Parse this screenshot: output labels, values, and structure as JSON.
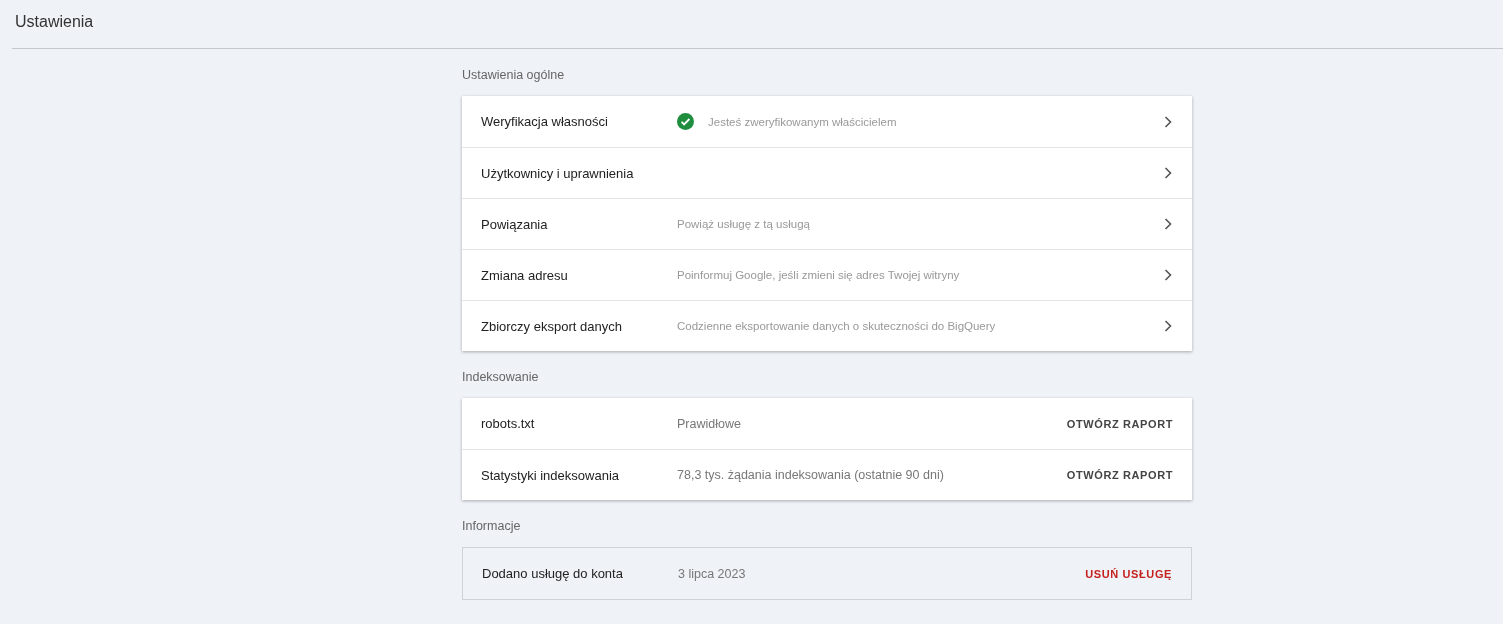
{
  "header": {
    "title": "Ustawienia"
  },
  "sections": [
    {
      "title": "Ustawienia ogólne",
      "kind": "raised",
      "rows": [
        {
          "kind": "link",
          "label": "Weryfikacja własności",
          "value": "Jesteś zweryfikowanym właścicielem",
          "verified": true
        },
        {
          "kind": "link",
          "label": "Użytkownicy i uprawnienia",
          "verified": false
        },
        {
          "kind": "link",
          "label": "Powiązania",
          "value": "Powiąż usługę z tą usługą",
          "verified": false
        },
        {
          "kind": "link",
          "label": "Zmiana adresu",
          "value": "Poinformuj Google, jeśli zmieni się adres Twojej witryny",
          "verified": false
        },
        {
          "kind": "link",
          "label": "Zbiorczy eksport danych",
          "value": "Codzienne eksportowanie danych o skuteczności do BigQuery",
          "verified": false
        }
      ]
    },
    {
      "title": "Indeksowanie",
      "kind": "raised",
      "rows": [
        {
          "kind": "action",
          "label": "robots.txt",
          "value": "Prawidłowe",
          "action": {
            "label": "OTWÓRZ RAPORT",
            "kind": "default"
          }
        },
        {
          "kind": "action",
          "label": "Statystyki indeksowania",
          "value": "78,3 tys. żądania indeksowania (ostatnie 90 dni)",
          "action": {
            "label": "OTWÓRZ RAPORT",
            "kind": "default"
          }
        }
      ]
    },
    {
      "title": "Informacje",
      "kind": "outlined",
      "rows": [
        {
          "kind": "action",
          "label": "Dodano usługę do konta",
          "value": "3 lipca 2023",
          "action": {
            "label": "USUŃ USŁUGĘ",
            "kind": "danger"
          }
        }
      ]
    }
  ]
}
